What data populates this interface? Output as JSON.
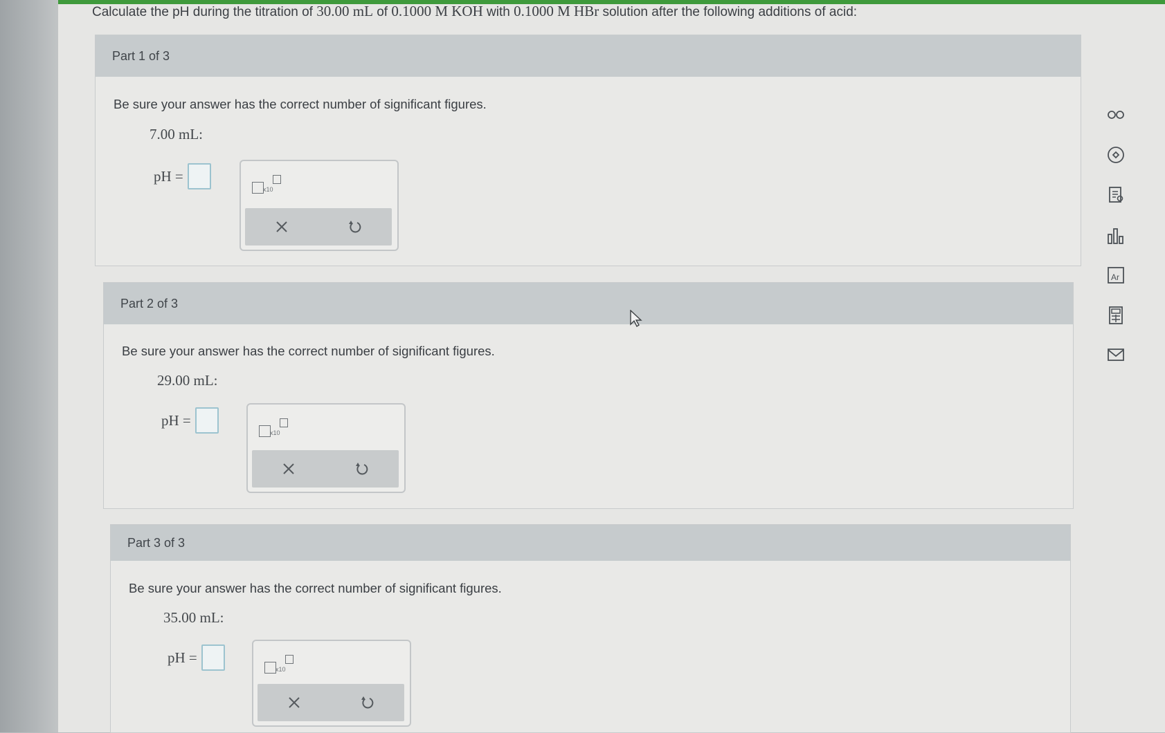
{
  "question": {
    "pre": "Calculate the pH during the titration of ",
    "vol": "30.00 mL",
    "mid1": " of ",
    "conc1": "0.1000 M KOH",
    "mid2": " with ",
    "conc2": "0.1000 M HBr",
    "post": " solution after the following additions of acid:"
  },
  "parts": [
    {
      "title": "Part 1 of 3",
      "instruction": "Be sure your answer has the correct number of significant figures.",
      "volume": "7.00 mL:",
      "ph_label": "pH =",
      "ph_value": ""
    },
    {
      "title": "Part 2 of 3",
      "instruction": "Be sure your answer has the correct number of significant figures.",
      "volume": "29.00 mL:",
      "ph_label": "pH =",
      "ph_value": ""
    },
    {
      "title": "Part 3 of 3",
      "instruction": "Be sure your answer has the correct number of significant figures.",
      "volume": "35.00 mL:",
      "ph_label": "pH =",
      "ph_value": ""
    }
  ],
  "tool": {
    "sci_notation_text": "x10"
  },
  "side_icons": [
    "infinity-icon",
    "compass-icon",
    "notes-icon",
    "bar-chart-icon",
    "periodic-table-icon",
    "calculator-icon",
    "mail-icon"
  ],
  "colors": {
    "accent_green": "#3f9a3c",
    "header_gray": "#c6cbcd",
    "input_border": "#9cc3cf"
  }
}
